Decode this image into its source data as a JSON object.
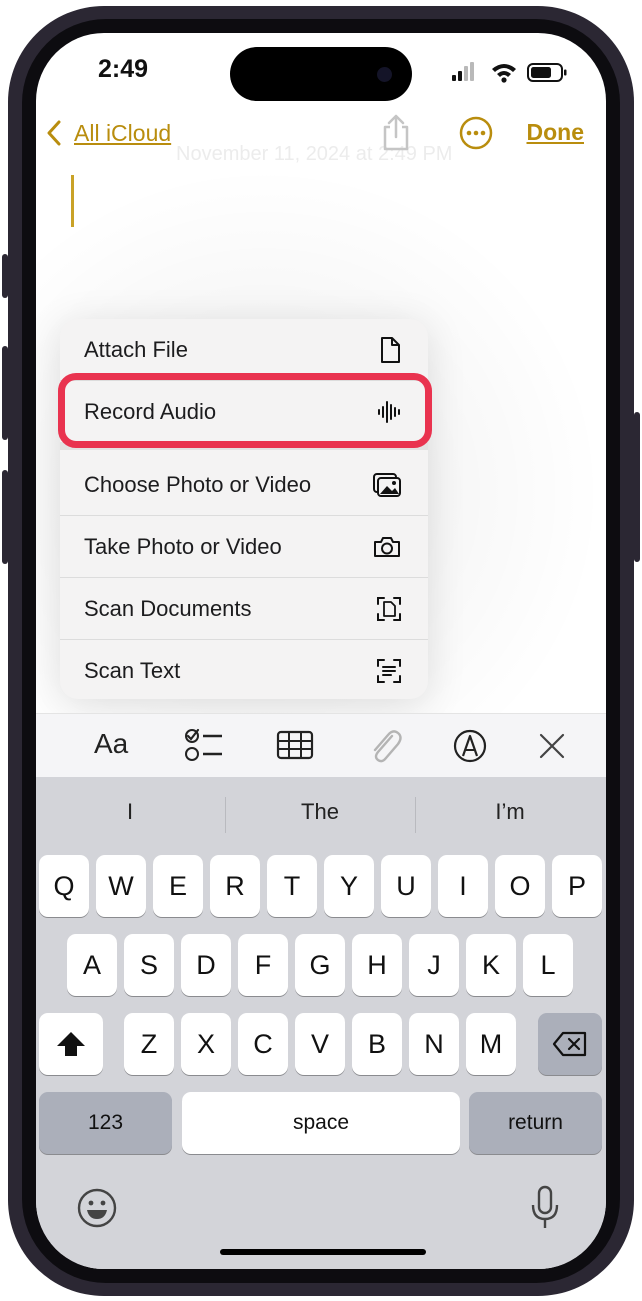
{
  "status": {
    "time": "2:49"
  },
  "nav": {
    "back_label": "All iCloud",
    "done_label": "Done",
    "faded_date": "November 11, 2024 at 2:49 PM"
  },
  "menu": {
    "items": [
      {
        "label": "Attach File",
        "icon": "doc-icon"
      },
      {
        "label": "Record Audio",
        "icon": "waveform-icon"
      },
      {
        "label": "Choose Photo or Video",
        "icon": "photos-icon"
      },
      {
        "label": "Take Photo or Video",
        "icon": "camera-icon"
      },
      {
        "label": "Scan Documents",
        "icon": "doc-scan-icon"
      },
      {
        "label": "Scan Text",
        "icon": "text-scan-icon"
      }
    ]
  },
  "toolbar": {
    "format_label": "Aa"
  },
  "keyboard": {
    "suggestions": [
      "I",
      "The",
      "I’m"
    ],
    "row1": [
      "Q",
      "W",
      "E",
      "R",
      "T",
      "Y",
      "U",
      "I",
      "O",
      "P"
    ],
    "row2": [
      "A",
      "S",
      "D",
      "F",
      "G",
      "H",
      "J",
      "K",
      "L"
    ],
    "row3": [
      "Z",
      "X",
      "C",
      "V",
      "B",
      "N",
      "M"
    ],
    "numbers_label": "123",
    "space_label": "space",
    "return_label": "return"
  },
  "colors": {
    "accent": "#b98d0e",
    "highlight": "#e9334f"
  }
}
